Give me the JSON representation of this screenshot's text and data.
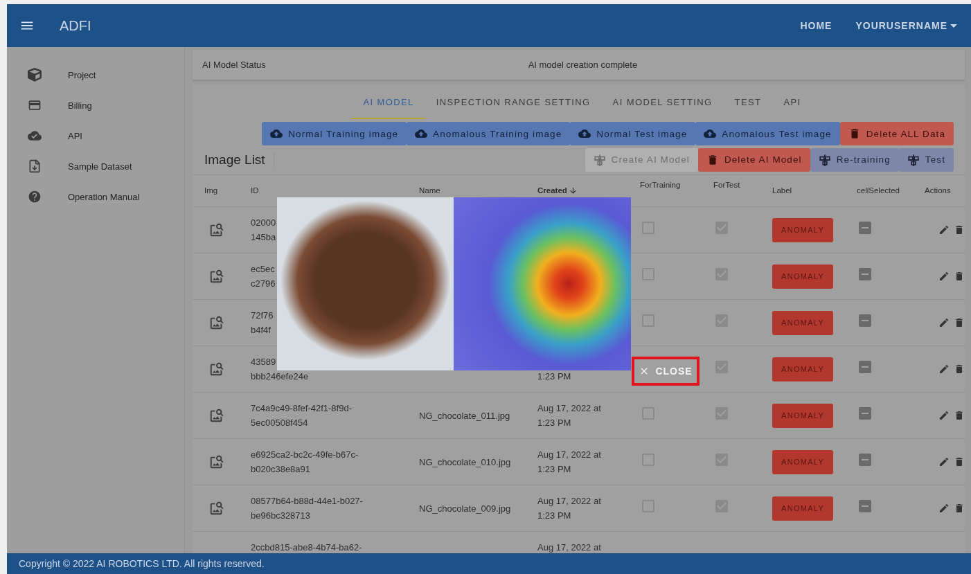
{
  "header": {
    "title": "ADFI",
    "home_link": "HOME",
    "user_menu": "YOURUSERNAME"
  },
  "sidebar": {
    "items": [
      {
        "label": "Project"
      },
      {
        "label": "Billing"
      },
      {
        "label": "API"
      },
      {
        "label": "Sample Dataset"
      },
      {
        "label": "Operation Manual"
      }
    ]
  },
  "status": {
    "label": "AI Model Status",
    "value": "AI model creation complete"
  },
  "tabs": [
    {
      "label": "AI MODEL",
      "selected": true
    },
    {
      "label": "INSPECTION RANGE SETTING",
      "selected": false
    },
    {
      "label": "AI MODEL SETTING",
      "selected": false
    },
    {
      "label": "TEST",
      "selected": false
    },
    {
      "label": "API",
      "selected": false
    }
  ],
  "upload_buttons": [
    {
      "label": "Normal Training image",
      "kind": "upload"
    },
    {
      "label": "Anomalous Training image",
      "kind": "upload"
    },
    {
      "label": "Normal Test image",
      "kind": "upload"
    },
    {
      "label": "Anomalous Test image",
      "kind": "upload"
    },
    {
      "label": "Delete ALL Data",
      "kind": "delete"
    }
  ],
  "section_title": "Image List",
  "action_buttons": [
    {
      "label": "Create AI Model",
      "kind": "train",
      "disabled": true
    },
    {
      "label": "Delete AI Model",
      "kind": "delete",
      "disabled": false
    },
    {
      "label": "Re-training",
      "kind": "train",
      "disabled": false
    },
    {
      "label": "Test",
      "kind": "train",
      "disabled": false
    }
  ],
  "table": {
    "columns": [
      {
        "label": "Img",
        "sorted": false
      },
      {
        "label": "ID",
        "sorted": false
      },
      {
        "label": "Name",
        "sorted": false
      },
      {
        "label": "Created",
        "sorted": true
      },
      {
        "label": "ForTraining",
        "sorted": false
      },
      {
        "label": "ForTest",
        "sorted": false
      },
      {
        "label": "Label",
        "sorted": false
      },
      {
        "label": "cellSelected",
        "sorted": false
      },
      {
        "label": "Actions",
        "sorted": false
      }
    ],
    "rows": [
      {
        "kind": "full",
        "id": [
          "02000",
          "145ba"
        ],
        "for_training": false,
        "for_test": true,
        "label": "ANOMALY",
        "cell_selected_mixed": true
      },
      {
        "kind": "full",
        "id": [
          "ec5ec",
          "c2796"
        ],
        "for_training": false,
        "for_test": true,
        "label": "ANOMALY",
        "cell_selected_mixed": true
      },
      {
        "kind": "full",
        "id": [
          "72f76",
          "b4f4f"
        ],
        "for_training": false,
        "for_test": true,
        "label": "ANOMALY",
        "cell_selected_mixed": true
      },
      {
        "kind": "full",
        "id": [
          "43589",
          "bbb246efe24e"
        ],
        "created": [
          "1:23 PM"
        ],
        "for_test": true,
        "label": "ANOMALY",
        "cell_selected_mixed": true
      },
      {
        "kind": "full",
        "id": [
          "7c4a9c49-8fef-42f1-8f9d-",
          "5ec00508f454"
        ],
        "name": "NG_chocolate_011.jpg",
        "created": [
          "Aug 17, 2022 at",
          "1:23 PM"
        ],
        "for_training": false,
        "for_test": true,
        "label": "ANOMALY",
        "cell_selected_mixed": true
      },
      {
        "kind": "full",
        "id": [
          "e6925ca2-bc2c-49fe-b67c-",
          "b020c38e8a91"
        ],
        "name": "NG_chocolate_010.jpg",
        "created": [
          "Aug 17, 2022 at",
          "1:23 PM"
        ],
        "for_training": false,
        "for_test": true,
        "label": "ANOMALY",
        "cell_selected_mixed": true
      },
      {
        "kind": "full",
        "id": [
          "08577b64-b88d-44e1-b027-",
          "be96bc328713"
        ],
        "name": "NG_chocolate_009.jpg",
        "created": [
          "Aug 17, 2022 at",
          "1:23 PM"
        ],
        "for_training": false,
        "for_test": true,
        "label": "ANOMALY",
        "cell_selected_mixed": true
      },
      {
        "kind": "partial",
        "id": [
          "2ccbd815-abe8-4b74-ba62-"
        ],
        "created": [
          "Aug 17, 2022 at"
        ]
      }
    ]
  },
  "preview": {
    "close_label": "CLOSE",
    "close_highlighted": true
  },
  "footer": "Copyright © 2022 AI ROBOTICS LTD. All rights reserved."
}
